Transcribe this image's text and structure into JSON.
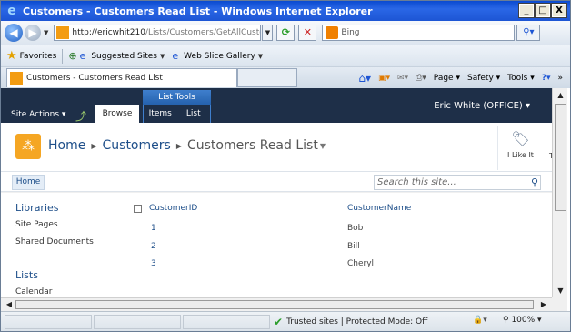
{
  "window": {
    "title": "Customers - Customers Read List - Windows Internet Explorer",
    "buttons": {
      "minimize": "_",
      "maximize": "□",
      "close": "X"
    }
  },
  "address_bar": {
    "url_host": "http://ericwhit210",
    "url_path": "/Lists/Customers/GetAllCustomers.",
    "search_placeholder": "Bing"
  },
  "favorites_bar": {
    "favorites_label": "Favorites",
    "suggested_sites": "Suggested Sites",
    "web_slice_gallery": "Web Slice Gallery"
  },
  "tab": {
    "title": "Customers - Customers Read List"
  },
  "command_bar": {
    "page": "Page",
    "safety": "Safety",
    "tools": "Tools"
  },
  "ribbon": {
    "site_actions": "Site Actions",
    "browse": "Browse",
    "list_tools": "List Tools",
    "items": "Items",
    "list": "List",
    "user": "Eric White (OFFICE)"
  },
  "breadcrumb": {
    "home": "Home",
    "list": "Customers",
    "view": "Customers Read List"
  },
  "like_it": "I Like It",
  "tags_cut": "T",
  "top_nav": {
    "home": "Home",
    "search_placeholder": "Search this site..."
  },
  "left_nav": {
    "libraries_heading": "Libraries",
    "items": [
      "Site Pages",
      "Shared Documents"
    ],
    "lists_heading": "Lists",
    "list_items": [
      "Calendar"
    ]
  },
  "table": {
    "columns": [
      "CustomerID",
      "CustomerName"
    ],
    "rows": [
      {
        "id": "1",
        "name": "Bob"
      },
      {
        "id": "2",
        "name": "Bill"
      },
      {
        "id": "3",
        "name": "Cheryl"
      }
    ]
  },
  "status_bar": {
    "zone": "Trusted sites | Protected Mode: Off",
    "zoom": "100%"
  },
  "colors": {
    "titlebar": "#1d55d4",
    "ribbon": "#1e2f48",
    "link": "#1d4e89",
    "accent_orange": "#f5a623"
  }
}
